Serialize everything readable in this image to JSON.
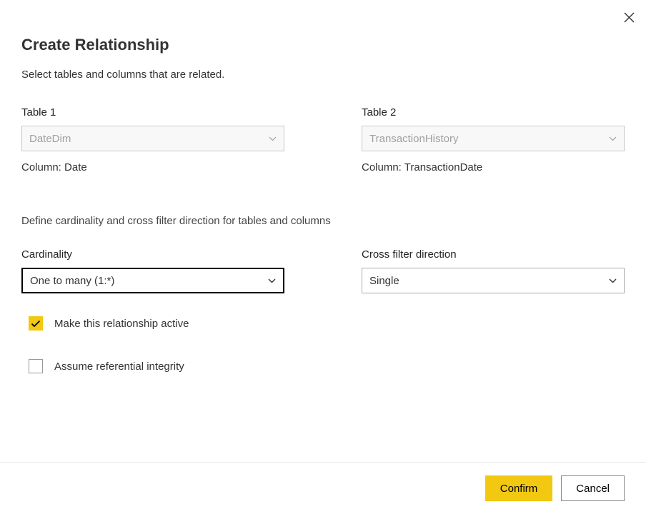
{
  "dialog": {
    "title": "Create Relationship",
    "subtitle": "Select tables and columns that are related.",
    "sectionText": "Define cardinality and cross filter direction for tables and columns"
  },
  "table1": {
    "label": "Table 1",
    "value": "DateDim",
    "columnLabel": "Column:",
    "columnValue": "Date"
  },
  "table2": {
    "label": "Table 2",
    "value": "TransactionHistory",
    "columnLabel": "Column:",
    "columnValue": "TransactionDate"
  },
  "cardinality": {
    "label": "Cardinality",
    "value": "One to many (1:*)"
  },
  "crossFilter": {
    "label": "Cross filter direction",
    "value": "Single"
  },
  "checkboxes": {
    "activeLabel": "Make this relationship active",
    "integrityLabel": "Assume referential integrity"
  },
  "buttons": {
    "confirm": "Confirm",
    "cancel": "Cancel"
  }
}
